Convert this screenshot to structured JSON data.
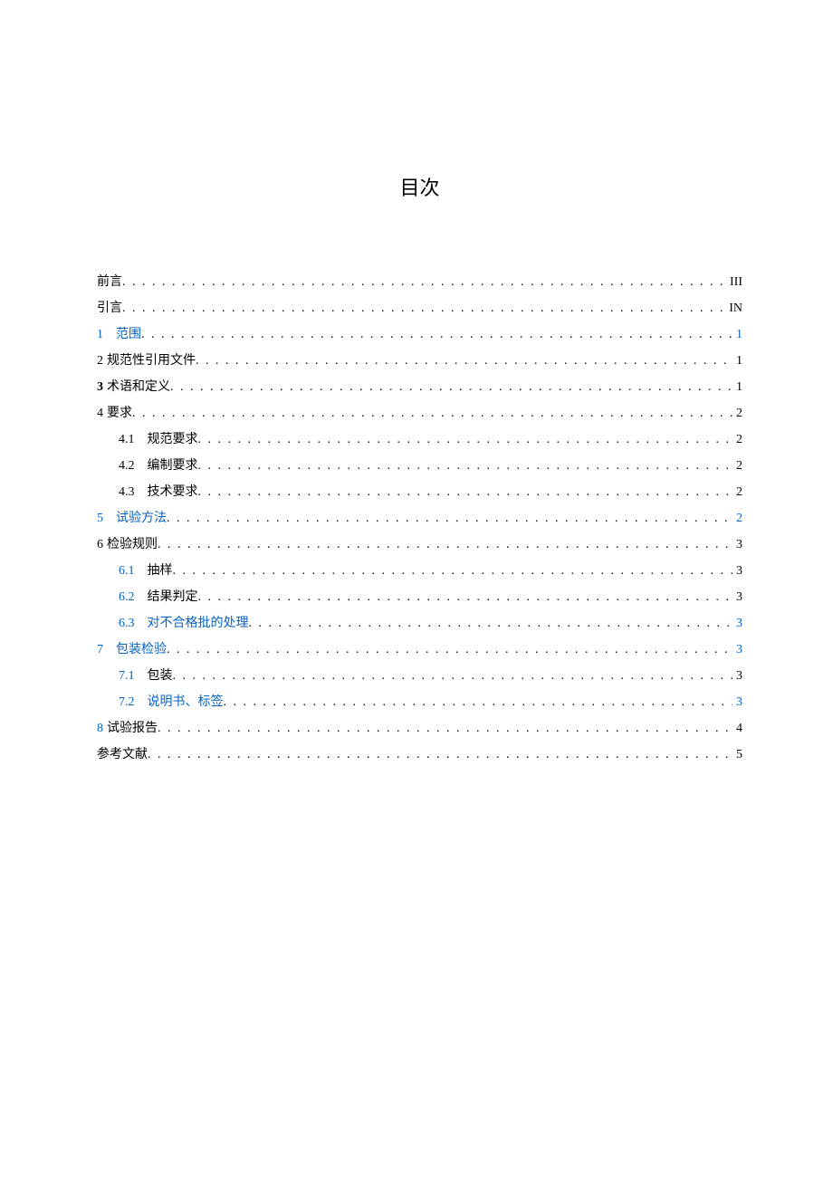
{
  "title": "目次",
  "entries": [
    {
      "num": "",
      "text": "前言",
      "page": "III",
      "indent": 0,
      "link": false,
      "gap": "none"
    },
    {
      "num": "",
      "text": "引言",
      "page": "IN",
      "indent": 0,
      "link": false,
      "gap": "none"
    },
    {
      "num": "1",
      "text": "范围",
      "page": "1",
      "indent": 0,
      "link": true,
      "gap": "wide"
    },
    {
      "num": "2",
      "text": "规范性引用文件",
      "page": "1",
      "indent": 0,
      "link": false,
      "gap": "narrow",
      "numBold": false
    },
    {
      "num": "3",
      "text": "术语和定义",
      "page": "1",
      "indent": 0,
      "link": false,
      "gap": "narrow",
      "numBold": true
    },
    {
      "num": "4",
      "text": "要求",
      "page": "2",
      "indent": 0,
      "link": false,
      "gap": "narrow"
    },
    {
      "num": "4.1",
      "text": "规范要求",
      "page": "2",
      "indent": 1,
      "link": false,
      "gap": "wide"
    },
    {
      "num": "4.2",
      "text": "编制要求",
      "page": "2",
      "indent": 1,
      "link": false,
      "gap": "wide"
    },
    {
      "num": "4.3",
      "text": "技术要求",
      "page": "2",
      "indent": 1,
      "link": false,
      "gap": "wide"
    },
    {
      "num": "5",
      "text": "试验方法",
      "page": "2",
      "indent": 0,
      "link": true,
      "gap": "wide"
    },
    {
      "num": "6",
      "text": "检验规则",
      "page": "3",
      "indent": 0,
      "link": false,
      "gap": "narrow"
    },
    {
      "num": "6.1",
      "text": "抽样",
      "page": "3",
      "indent": 1,
      "link": false,
      "gap": "wide",
      "numLink": true
    },
    {
      "num": "6.2",
      "text": "结果判定",
      "page": "3",
      "indent": 1,
      "link": false,
      "gap": "wide",
      "numLink": true
    },
    {
      "num": "6.3",
      "text": "对不合格批的处理",
      "page": "3",
      "indent": 1,
      "link": true,
      "gap": "wide"
    },
    {
      "num": "7",
      "text": "包装检验",
      "page": "3",
      "indent": 0,
      "link": true,
      "gap": "wide"
    },
    {
      "num": "7.1",
      "text": "包装",
      "page": "3",
      "indent": 1,
      "link": false,
      "gap": "wide",
      "numLink": true
    },
    {
      "num": "7.2",
      "text": "说明书、标签",
      "page": "3",
      "indent": 1,
      "link": true,
      "gap": "wide"
    },
    {
      "num": "8",
      "text": "试验报告",
      "page": "4",
      "indent": 0,
      "link": false,
      "gap": "narrow",
      "numLink": true
    },
    {
      "num": "",
      "text": "参考文献",
      "page": "5",
      "indent": 0,
      "link": false,
      "gap": "none"
    }
  ]
}
